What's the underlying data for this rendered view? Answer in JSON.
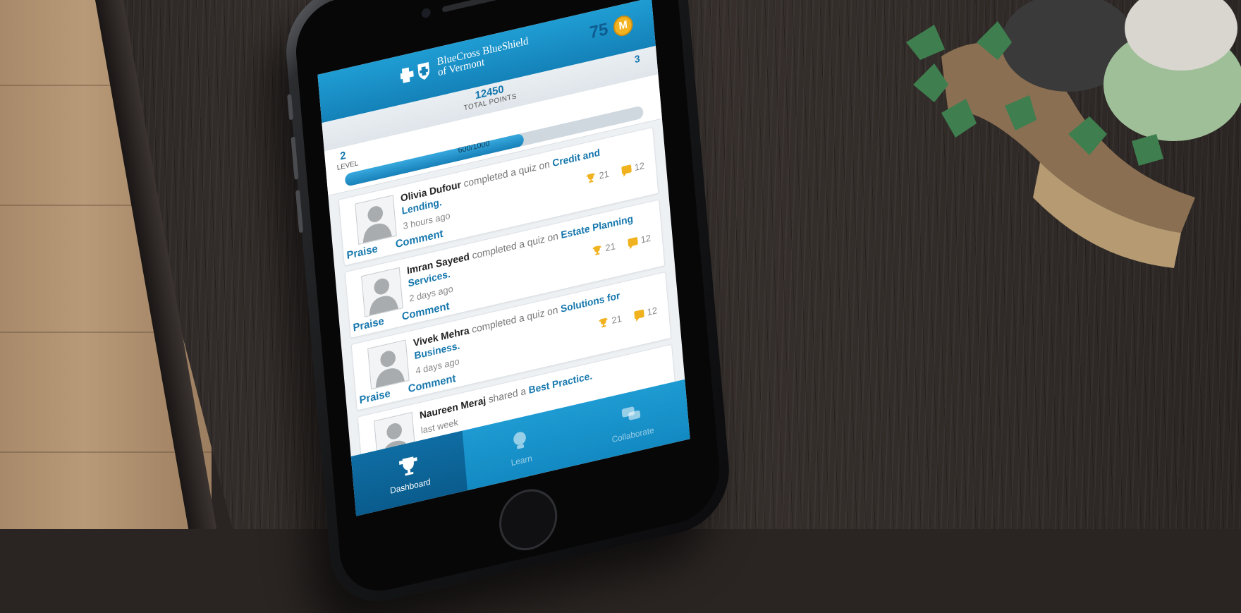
{
  "app": {
    "brand_line1": "BlueCross BlueShield",
    "brand_line2": "of Vermont",
    "points": "75",
    "coin_glyph": "M"
  },
  "summary": {
    "total_points": "12450",
    "total_label": "TOTAL POINTS",
    "badge_count": "3",
    "level": "2",
    "level_label": "LEVEL",
    "progress_text": "600/1000",
    "progress_fraction": 0.6
  },
  "feed": [
    {
      "actor": "Olivia Dufour",
      "verb": "completed a quiz on",
      "topic": "Credit and Lending.",
      "when": "3 hours ago",
      "trophies": "21",
      "comments": "12",
      "praise": "Praise",
      "comment": "Comment"
    },
    {
      "actor": "Imran Sayeed",
      "verb": "completed a quiz on",
      "topic": "Estate Planning Services.",
      "when": "2 days ago",
      "trophies": "21",
      "comments": "12",
      "praise": "Praise",
      "comment": "Comment"
    },
    {
      "actor": "Vivek Mehra",
      "verb": "completed a quiz on",
      "topic": "Solutions for Business.",
      "when": "4 days ago",
      "trophies": "21",
      "comments": "12",
      "praise": "Praise",
      "comment": "Comment"
    },
    {
      "actor": "Naureen Meraj",
      "verb": "shared a",
      "topic": "Best Practice.",
      "when": "last week",
      "trophies": "",
      "comments": "",
      "praise": "",
      "comment": ""
    }
  ],
  "tabs": [
    {
      "label": "Dashboard",
      "icon": "trophy-icon",
      "active": true
    },
    {
      "label": "Learn",
      "icon": "lightbulb-icon",
      "active": false
    },
    {
      "label": "Collaborate",
      "icon": "chat-bubbles-icon",
      "active": false
    }
  ],
  "colors": {
    "brand_blue": "#1482b9",
    "link_blue": "#1677ad",
    "coin_gold": "#f3b321"
  }
}
